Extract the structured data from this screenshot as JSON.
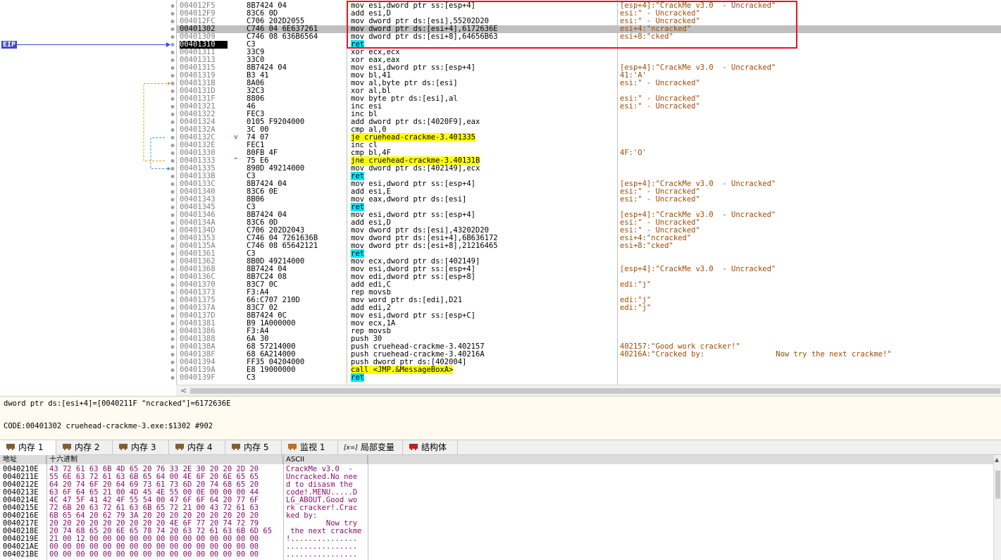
{
  "eip_label": "EIP",
  "disasm": {
    "rows": [
      {
        "addr": "004012F5",
        "mark": "",
        "bytes": "8B7424 04",
        "instr": [
          [
            "mov esi,dword ptr ss:[esp+4]",
            ""
          ]
        ],
        "comment": "[esp+4]:\"CrackMe v3.0  - Uncracked\""
      },
      {
        "addr": "004012F9",
        "mark": "",
        "bytes": "83C6 0D",
        "instr": [
          [
            "add esi,D",
            ""
          ]
        ],
        "comment": "esi:\" - Uncracked\""
      },
      {
        "addr": "004012FC",
        "mark": "",
        "bytes": "C706 202D2055",
        "instr": [
          [
            "mov dword ptr ds:[esi],55202D20",
            ""
          ]
        ],
        "comment": "esi:\" - Uncracked\""
      },
      {
        "addr": "00401302",
        "mark": "",
        "bytes": "C746 04 6E637261",
        "instr": [
          [
            "mov dword ptr ds:[esi+4],6172636E",
            ""
          ]
        ],
        "comment": "esi+4:\"ncracked\"",
        "selected": true
      },
      {
        "addr": "00401309",
        "mark": "",
        "bytes": "C746 08 636B6564",
        "instr": [
          [
            "mov dword ptr ds:[esi+8],64656B63",
            ""
          ]
        ],
        "comment": "esi+8:\"cked\""
      },
      {
        "addr": "00401310",
        "mark": "",
        "bytes": "C3",
        "instr": [
          [
            "ret",
            "c"
          ]
        ],
        "comment": "",
        "current": true
      },
      {
        "addr": "00401311",
        "mark": "",
        "bytes": "33C9",
        "instr": [
          [
            "xor ecx,ecx",
            ""
          ]
        ],
        "comment": ""
      },
      {
        "addr": "00401313",
        "mark": "",
        "bytes": "33C0",
        "instr": [
          [
            "xor eax,eax",
            ""
          ]
        ],
        "comment": ""
      },
      {
        "addr": "00401315",
        "mark": "",
        "bytes": "8B7424 04",
        "instr": [
          [
            "mov esi,dword ptr ss:[esp+4]",
            ""
          ]
        ],
        "comment": "[esp+4]:\"CrackMe v3.0  - Uncracked\""
      },
      {
        "addr": "00401319",
        "mark": "",
        "bytes": "B3 41",
        "instr": [
          [
            "mov bl,41",
            ""
          ]
        ],
        "comment": "41:'A'"
      },
      {
        "addr": "0040131B",
        "mark": "",
        "bytes": "8A06",
        "instr": [
          [
            "mov al,byte ptr ds:[esi]",
            ""
          ]
        ],
        "comment": "esi:\" - Uncracked\""
      },
      {
        "addr": "0040131D",
        "mark": "",
        "bytes": "32C3",
        "instr": [
          [
            "xor al,bl",
            ""
          ]
        ],
        "comment": ""
      },
      {
        "addr": "0040131F",
        "mark": "",
        "bytes": "8806",
        "instr": [
          [
            "mov byte ptr ds:[esi],al",
            ""
          ]
        ],
        "comment": "esi:\" - Uncracked\""
      },
      {
        "addr": "00401321",
        "mark": "",
        "bytes": "46",
        "instr": [
          [
            "inc esi",
            ""
          ]
        ],
        "comment": "esi:\" - Uncracked\""
      },
      {
        "addr": "00401322",
        "mark": "",
        "bytes": "FEC3",
        "instr": [
          [
            "inc bl",
            ""
          ]
        ],
        "comment": ""
      },
      {
        "addr": "00401324",
        "mark": "",
        "bytes": "0105 F9204000",
        "instr": [
          [
            "add dword ptr ds:[4020F9],eax",
            ""
          ]
        ],
        "comment": ""
      },
      {
        "addr": "0040132A",
        "mark": "",
        "bytes": "3C 00",
        "instr": [
          [
            "cmp al,0",
            ""
          ]
        ],
        "comment": ""
      },
      {
        "addr": "0040132C",
        "mark": "v",
        "bytes": "74 07",
        "instr": [
          [
            "je cruehead-crackme-3.401335",
            "y"
          ]
        ],
        "comment": ""
      },
      {
        "addr": "0040132E",
        "mark": "",
        "bytes": "FEC1",
        "instr": [
          [
            "inc cl",
            ""
          ]
        ],
        "comment": ""
      },
      {
        "addr": "00401330",
        "mark": "",
        "bytes": "80FB 4F",
        "instr": [
          [
            "cmp bl,4F",
            ""
          ]
        ],
        "comment": "4F:'O'"
      },
      {
        "addr": "00401333",
        "mark": "^",
        "bytes": "75 E6",
        "instr": [
          [
            "jne cruehead-crackme-3.40131B",
            "y"
          ]
        ],
        "comment": ""
      },
      {
        "addr": "00401335",
        "mark": "",
        "bytes": "890D 49214000",
        "instr": [
          [
            "mov dword ptr ds:[402149],ecx",
            ""
          ]
        ],
        "comment": ""
      },
      {
        "addr": "0040133B",
        "mark": "",
        "bytes": "C3",
        "instr": [
          [
            "ret",
            "c"
          ]
        ],
        "comment": ""
      },
      {
        "addr": "0040133C",
        "mark": "",
        "bytes": "8B7424 04",
        "instr": [
          [
            "mov esi,dword ptr ss:[esp+4]",
            ""
          ]
        ],
        "comment": "[esp+4]:\"CrackMe v3.0  - Uncracked\""
      },
      {
        "addr": "00401340",
        "mark": "",
        "bytes": "83C6 0E",
        "instr": [
          [
            "add esi,E",
            ""
          ]
        ],
        "comment": "esi:\" - Uncracked\""
      },
      {
        "addr": "00401343",
        "mark": "",
        "bytes": "8B06",
        "instr": [
          [
            "mov eax,dword ptr ds:[esi]",
            ""
          ]
        ],
        "comment": "esi:\" - Uncracked\""
      },
      {
        "addr": "00401345",
        "mark": "",
        "bytes": "C3",
        "instr": [
          [
            "ret",
            "c"
          ]
        ],
        "comment": ""
      },
      {
        "addr": "00401346",
        "mark": "",
        "bytes": "8B7424 04",
        "instr": [
          [
            "mov esi,dword ptr ss:[esp+4]",
            ""
          ]
        ],
        "comment": "[esp+4]:\"CrackMe v3.0  - Uncracked\""
      },
      {
        "addr": "0040134A",
        "mark": "",
        "bytes": "83C6 0D",
        "instr": [
          [
            "add esi,D",
            ""
          ]
        ],
        "comment": "esi:\" - Uncracked\""
      },
      {
        "addr": "0040134D",
        "mark": "",
        "bytes": "C706 202D2043",
        "instr": [
          [
            "mov dword ptr ds:[esi],43202D20",
            ""
          ]
        ],
        "comment": "esi:\" - Uncracked\""
      },
      {
        "addr": "00401353",
        "mark": "",
        "bytes": "C746 04 7261636B",
        "instr": [
          [
            "mov dword ptr ds:[esi+4],6B636172",
            ""
          ]
        ],
        "comment": "esi+4:\"ncracked\""
      },
      {
        "addr": "0040135A",
        "mark": "",
        "bytes": "C746 08 65642121",
        "instr": [
          [
            "mov dword ptr ds:[esi+8],21216465",
            ""
          ]
        ],
        "comment": "esi+8:\"cked\""
      },
      {
        "addr": "00401361",
        "mark": "",
        "bytes": "C3",
        "instr": [
          [
            "ret",
            "c"
          ]
        ],
        "comment": ""
      },
      {
        "addr": "00401362",
        "mark": "",
        "bytes": "8B0D 49214000",
        "instr": [
          [
            "mov ecx,dword ptr ds:[402149]",
            ""
          ]
        ],
        "comment": ""
      },
      {
        "addr": "00401368",
        "mark": "",
        "bytes": "8B7424 04",
        "instr": [
          [
            "mov esi,dword ptr ss:[esp+4]",
            ""
          ]
        ],
        "comment": "[esp+4]:\"CrackMe v3.0  - Uncracked\""
      },
      {
        "addr": "0040136C",
        "mark": "",
        "bytes": "8B7C24 08",
        "instr": [
          [
            "mov edi,dword ptr ss:[esp+8]",
            ""
          ]
        ],
        "comment": ""
      },
      {
        "addr": "00401370",
        "mark": "",
        "bytes": "83C7 0C",
        "instr": [
          [
            "add edi,C",
            ""
          ]
        ],
        "comment": "edi:\"j\""
      },
      {
        "addr": "00401373",
        "mark": "",
        "bytes": "F3:A4",
        "instr": [
          [
            "rep movsb",
            ""
          ]
        ],
        "comment": ""
      },
      {
        "addr": "00401375",
        "mark": "",
        "bytes": "66:C707 210D",
        "instr": [
          [
            "mov word ptr ds:[edi],D21",
            ""
          ]
        ],
        "comment": "edi:\"j\""
      },
      {
        "addr": "0040137A",
        "mark": "",
        "bytes": "83C7 02",
        "instr": [
          [
            "add edi,2",
            ""
          ]
        ],
        "comment": "edi:\"j\""
      },
      {
        "addr": "0040137D",
        "mark": "",
        "bytes": "8B7424 0C",
        "instr": [
          [
            "mov esi,dword ptr ss:[esp+C]",
            ""
          ]
        ],
        "comment": ""
      },
      {
        "addr": "00401381",
        "mark": "",
        "bytes": "B9 1A000000",
        "instr": [
          [
            "mov ecx,1A",
            ""
          ]
        ],
        "comment": ""
      },
      {
        "addr": "00401386",
        "mark": "",
        "bytes": "F3:A4",
        "instr": [
          [
            "rep movsb",
            ""
          ]
        ],
        "comment": ""
      },
      {
        "addr": "00401388",
        "mark": "",
        "bytes": "6A 30",
        "instr": [
          [
            "push 30",
            ""
          ]
        ],
        "comment": ""
      },
      {
        "addr": "0040138A",
        "mark": "",
        "bytes": "68 57214000",
        "instr": [
          [
            "push cruehead-crackme-3.402157",
            ""
          ]
        ],
        "comment": "402157:\"Good work cracker!\""
      },
      {
        "addr": "0040138F",
        "mark": "",
        "bytes": "68 6A214000",
        "instr": [
          [
            "push cruehead-crackme-3.40216A",
            ""
          ]
        ],
        "comment": "40216A:\"Cracked by:                Now try the next crackme!\""
      },
      {
        "addr": "00401394",
        "mark": "",
        "bytes": "FF35 04204000",
        "instr": [
          [
            "push dword ptr ds:[402004]",
            ""
          ]
        ],
        "comment": ""
      },
      {
        "addr": "0040139A",
        "mark": "",
        "bytes": "E8 19000000",
        "instr": [
          [
            "call <JMP.&MessageBoxA>",
            "y"
          ]
        ],
        "comment": ""
      },
      {
        "addr": "0040139F",
        "mark": "",
        "bytes": "C3",
        "instr": [
          [
            "ret",
            "c"
          ]
        ],
        "comment": ""
      }
    ]
  },
  "info": {
    "line1": "dword ptr ds:[esi+4]=[0040211F \"ncracked\"]=6172636E",
    "line2": "CODE:00401302 cruehead-crackme-3.exe:$1302 #902"
  },
  "tabs": [
    {
      "label": "内存 1",
      "icon": "memory-icon",
      "active": true
    },
    {
      "label": "内存 2",
      "icon": "memory-icon"
    },
    {
      "label": "内存 3",
      "icon": "memory-icon"
    },
    {
      "label": "内存 4",
      "icon": "memory-icon"
    },
    {
      "label": "内存 5",
      "icon": "memory-icon"
    },
    {
      "label": "监视 1",
      "icon": "watch-icon"
    },
    {
      "label": "局部变量",
      "icon": "locals-icon",
      "prefix": "[x=]"
    },
    {
      "label": "结构体",
      "icon": "struct-icon"
    }
  ],
  "dump": {
    "headers": {
      "addr": "地址",
      "hex": "十六进制",
      "ascii": "ASCII"
    },
    "rows": [
      {
        "addr": "0040210E",
        "hex": "43 72 61 63 6B 4D 65 20 76 33 2E 30 20 20 2D 20",
        "ascii": "CrackMe v3.0  - "
      },
      {
        "addr": "0040211E",
        "hex": "55 6E 63 72 61 63 6B 65 64 00 4E 6F 20 6E 65 65",
        "ascii": "Uncracked.No nee"
      },
      {
        "addr": "0040212E",
        "hex": "64 20 74 6F 20 64 69 73 61 73 6D 20 74 68 65 20",
        "ascii": "d to disasm the "
      },
      {
        "addr": "0040213E",
        "hex": "63 6F 64 65 21 00 4D 45 4E 55 00 0E 00 00 00 44",
        "ascii": "code!.MENU.....D"
      },
      {
        "addr": "0040214E",
        "hex": "4C 47 5F 41 42 4F 55 54 00 47 6F 6F 64 20 77 6F",
        "ascii": "LG_ABOUT.Good wo"
      },
      {
        "addr": "0040215E",
        "hex": "72 6B 20 63 72 61 63 6B 65 72 21 00 43 72 61 63",
        "ascii": "rk cracker!.Crac"
      },
      {
        "addr": "0040216E",
        "hex": "6B 65 64 20 62 79 3A 20 20 20 20 20 20 20 20 20",
        "ascii": "ked by:         "
      },
      {
        "addr": "0040217E",
        "hex": "20 20 20 20 20 20 20 20 20 4E 6F 77 20 74 72 79",
        "ascii": "         Now try"
      },
      {
        "addr": "0040218E",
        "hex": "20 74 68 65 20 6E 65 78 74 20 63 72 61 63 6B 6D 65",
        "ascii": " the next crackme"
      },
      {
        "addr": "0040219E",
        "hex": "21 00 12 00 00 00 00 00 00 00 00 00 00 00 00 00",
        "ascii": "!..............."
      },
      {
        "addr": "004021AE",
        "hex": "00 00 00 00 00 00 00 00 00 00 00 00 00 00 00 00",
        "ascii": "................"
      },
      {
        "addr": "004021BE",
        "hex": "00 00 00 00 00 00 00 00 00 00 00 00 00 00 00 00",
        "ascii": "................"
      }
    ]
  },
  "colors": {
    "eip": "#3f48cc",
    "jump_highlight": "#ffff00",
    "ret_highlight": "#00e5ff",
    "annotation_box": "#e81123"
  }
}
